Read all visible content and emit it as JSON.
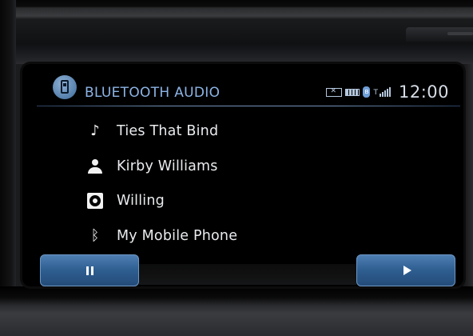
{
  "header": {
    "title": "BLUETOOTH AUDIO",
    "clock": "12:00",
    "status_icons": [
      "message-icon",
      "battery-icon",
      "bluetooth-icon",
      "signal-icon"
    ]
  },
  "track": {
    "song": "Ties That Bind",
    "artist": "Kirby Williams",
    "album": "Willing",
    "device": "My Mobile Phone"
  },
  "icons": {
    "song": "music-note-icon",
    "artist": "person-icon",
    "album": "disc-icon",
    "device": "bluetooth-icon"
  },
  "controls": {
    "left": "pause",
    "right": "play"
  },
  "colors": {
    "title": "#8db4e6",
    "button": "#2e5d90",
    "background": "#000000"
  }
}
